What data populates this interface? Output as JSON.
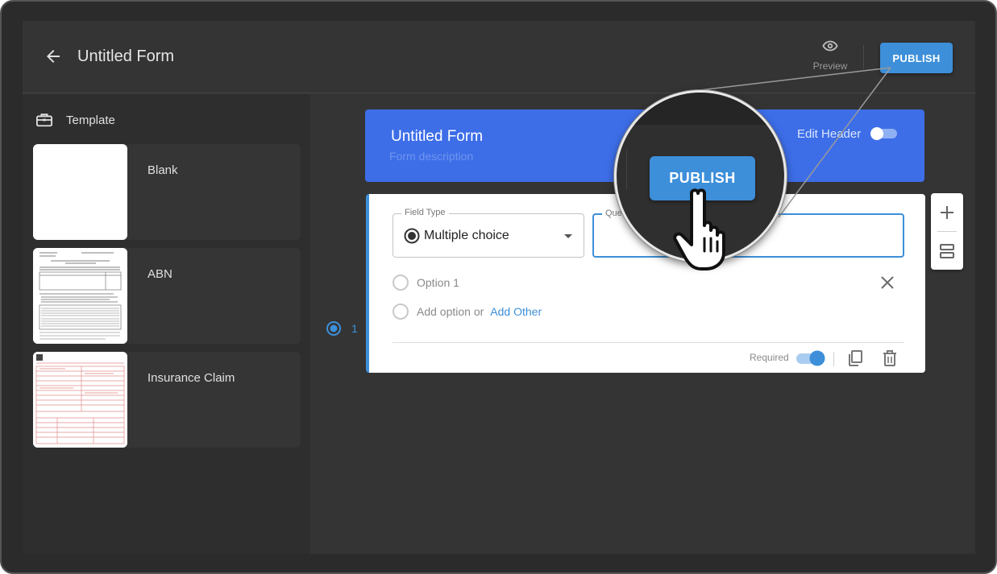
{
  "topbar": {
    "title": "Untitled Form",
    "preview_label": "Preview",
    "publish_label": "PUBLISH"
  },
  "sidebar": {
    "header_label": "Template",
    "templates": [
      {
        "label": "Blank"
      },
      {
        "label": "ABN"
      },
      {
        "label": "Insurance Claim"
      }
    ]
  },
  "header_card": {
    "title": "Untitled Form",
    "description_placeholder": "Form description",
    "edit_header_label": "Edit Header",
    "edit_header_on": false
  },
  "question": {
    "number": "1",
    "field_type_label": "Field Type",
    "field_type_value": "Multiple choice",
    "question_label": "Ques",
    "options": [
      {
        "label": "Option 1"
      }
    ],
    "add_option_label": "Add option or",
    "add_other_label": "Add Other",
    "required_label": "Required",
    "required_on": true
  },
  "magnifier": {
    "publish_label": "PUBLISH"
  },
  "colors": {
    "accent": "#3d8fd9",
    "header_blue": "#3d6ee8",
    "background": "#343434"
  }
}
